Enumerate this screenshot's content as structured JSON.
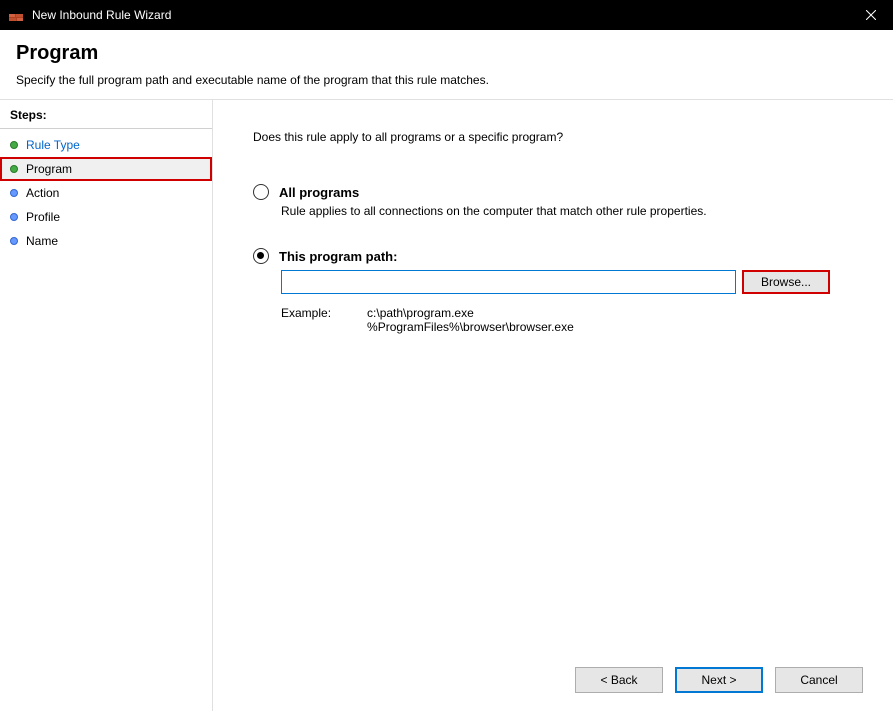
{
  "titlebar": {
    "title": "New Inbound Rule Wizard"
  },
  "header": {
    "title": "Program",
    "subtitle": "Specify the full program path and executable name of the program that this rule matches."
  },
  "sidebar": {
    "steps_label": "Steps:",
    "items": [
      {
        "label": "Rule Type",
        "state": "link"
      },
      {
        "label": "Program",
        "state": "current"
      },
      {
        "label": "Action",
        "state": "pending"
      },
      {
        "label": "Profile",
        "state": "pending"
      },
      {
        "label": "Name",
        "state": "pending"
      }
    ]
  },
  "content": {
    "question": "Does this rule apply to all programs or a specific program?",
    "option_all": {
      "label": "All programs",
      "desc": "Rule applies to all connections on the computer that match other rule properties."
    },
    "option_path": {
      "label": "This program path:",
      "value": "",
      "browse_label": "Browse...",
      "example_label": "Example:",
      "example_paths": "c:\\path\\program.exe\n%ProgramFiles%\\browser\\browser.exe"
    }
  },
  "buttons": {
    "back": "< Back",
    "next": "Next >",
    "cancel": "Cancel"
  }
}
